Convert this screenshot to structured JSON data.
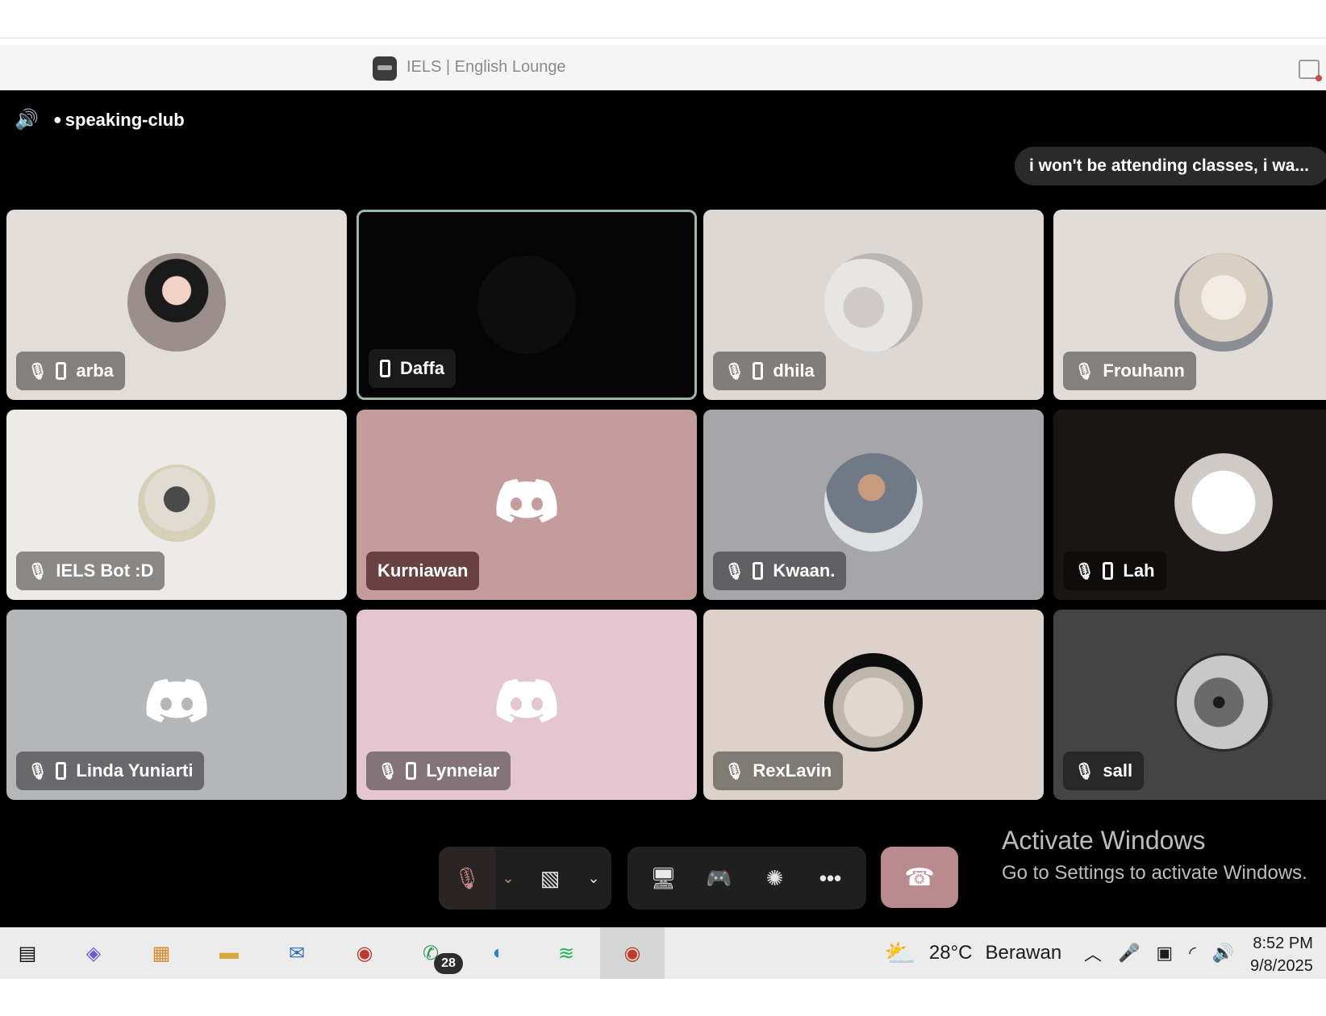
{
  "window": {
    "title": "IELS | English Lounge"
  },
  "voice": {
    "channel_name": "speaking-club",
    "toast_message": "i won't be attending classes, i wa..."
  },
  "participants": [
    {
      "name": "arba",
      "muted": true,
      "mobile": true,
      "avatar": "photo-avatar"
    },
    {
      "name": "Daffa",
      "muted": false,
      "mobile": true,
      "avatar": "dark-avatar",
      "speaking": true
    },
    {
      "name": "dhila",
      "muted": true,
      "mobile": true,
      "avatar": "cat-photo-avatar"
    },
    {
      "name": "Frouhann",
      "muted": true,
      "mobile": false,
      "avatar": "anime-avatar"
    },
    {
      "name": "IELS Bot :D",
      "muted": true,
      "mobile": false,
      "avatar": "raccoon-avatar"
    },
    {
      "name": "Kurniawan",
      "muted": false,
      "mobile": false,
      "avatar": "discord-default-avatar"
    },
    {
      "name": "Kwaan.",
      "muted": true,
      "mobile": true,
      "avatar": "photo-avatar"
    },
    {
      "name": "Lah",
      "muted": true,
      "mobile": true,
      "avatar": "white-creature-avatar"
    },
    {
      "name": "Linda Yuniarti",
      "muted": true,
      "mobile": true,
      "avatar": "discord-default-avatar"
    },
    {
      "name": "Lynneiar",
      "muted": true,
      "mobile": true,
      "avatar": "discord-default-avatar"
    },
    {
      "name": "RexLavin",
      "muted": true,
      "mobile": false,
      "avatar": "cat-photo-avatar"
    },
    {
      "name": "sall",
      "muted": true,
      "mobile": false,
      "avatar": "photo-avatar"
    }
  ],
  "controls": {
    "mic": "mic-muted-icon",
    "camera": "camera-off-icon",
    "share": "screen-share-icon",
    "activity": "gamepad-icon",
    "soundboard": "soundboard-icon",
    "more": "more-icon",
    "leave": "hang-up-icon"
  },
  "watermark": {
    "title": "Activate Windows",
    "subtitle": "Go to Settings to activate Windows."
  },
  "taskbar": {
    "whatsapp_badge": "28",
    "temperature": "28°C",
    "condition": "Berawan",
    "time": "8:52 PM",
    "date": "9/8/2025"
  }
}
